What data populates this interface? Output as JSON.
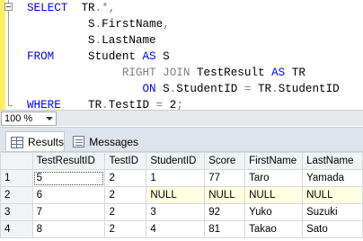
{
  "editor": {
    "lines": [
      {
        "kw": "SELECT",
        "pre": "  ",
        "parts": [
          {
            "t": "id",
            "v": "TR"
          },
          {
            "t": "gr",
            "v": ".*,"
          }
        ]
      },
      {
        "kw": "",
        "pre": "         ",
        "parts": [
          {
            "t": "id",
            "v": "S"
          },
          {
            "t": "gr",
            "v": "."
          },
          {
            "t": "id",
            "v": "FirstName"
          },
          {
            "t": "gr",
            "v": ","
          }
        ]
      },
      {
        "kw": "",
        "pre": "         ",
        "parts": [
          {
            "t": "id",
            "v": "S"
          },
          {
            "t": "gr",
            "v": "."
          },
          {
            "t": "id",
            "v": "LastName"
          }
        ]
      },
      {
        "kw": "FROM",
        "pre": "     ",
        "parts": [
          {
            "t": "id",
            "v": "Student "
          },
          {
            "t": "kw",
            "v": "AS"
          },
          {
            "t": "id",
            "v": " S"
          }
        ]
      },
      {
        "kw": "",
        "pre": "              ",
        "parts": [
          {
            "t": "gr",
            "v": "RIGHT JOIN"
          },
          {
            "t": "id",
            "v": " TestResult "
          },
          {
            "t": "kw",
            "v": "AS"
          },
          {
            "t": "id",
            "v": " TR"
          }
        ]
      },
      {
        "kw": "",
        "pre": "                 ",
        "parts": [
          {
            "t": "kw",
            "v": "ON"
          },
          {
            "t": "id",
            "v": " S"
          },
          {
            "t": "gr",
            "v": "."
          },
          {
            "t": "id",
            "v": "StudentID "
          },
          {
            "t": "gr",
            "v": "="
          },
          {
            "t": "id",
            "v": " TR"
          },
          {
            "t": "gr",
            "v": "."
          },
          {
            "t": "id",
            "v": "StudentID"
          }
        ]
      },
      {
        "kw": "WHERE",
        "pre": "    ",
        "parts": [
          {
            "t": "id",
            "v": "TR"
          },
          {
            "t": "gr",
            "v": "."
          },
          {
            "t": "id",
            "v": "TestID "
          },
          {
            "t": "gr",
            "v": "="
          },
          {
            "t": "id",
            "v": " 2"
          },
          {
            "t": "gr",
            "v": ";"
          }
        ]
      }
    ]
  },
  "zoom": {
    "value": "100 %"
  },
  "tabs": {
    "results": "Results",
    "messages": "Messages"
  },
  "grid": {
    "columns": [
      "TestResultID",
      "TestID",
      "StudentID",
      "Score",
      "FirstName",
      "LastName"
    ],
    "rows": [
      {
        "n": "1",
        "cells": [
          "5",
          "2",
          "1",
          "77",
          "Taro",
          "Yamada"
        ]
      },
      {
        "n": "2",
        "cells": [
          "6",
          "2",
          "NULL",
          "NULL",
          "NULL",
          "NULL"
        ]
      },
      {
        "n": "3",
        "cells": [
          "7",
          "2",
          "3",
          "92",
          "Yuko",
          "Suzuki"
        ]
      },
      {
        "n": "4",
        "cells": [
          "8",
          "2",
          "4",
          "81",
          "Takao",
          "Sato"
        ]
      }
    ]
  },
  "colors": {
    "gutter": "#ffee62",
    "keyword": "#0000ff",
    "operator": "#808080",
    "null_cell": "#ffffe1"
  }
}
